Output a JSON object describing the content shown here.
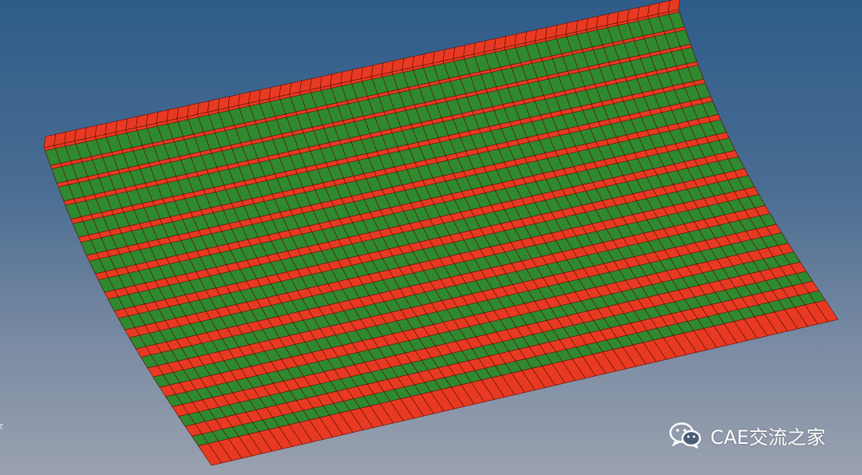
{
  "viewport": {
    "axis_label": "z",
    "background_top": "#2f5c8a",
    "background_bottom": "#9aa1b0"
  },
  "model": {
    "description_type": "curved stiffened panel FE mesh",
    "skin_color": "#e83a22",
    "stiffener_color": "#2f8a2f",
    "edge_color": "#5a0d06",
    "stiffener_count": 16,
    "skin_strip_count": 17
  },
  "watermark": {
    "text": "CAE交流之家",
    "icon": "wechat-icon"
  }
}
